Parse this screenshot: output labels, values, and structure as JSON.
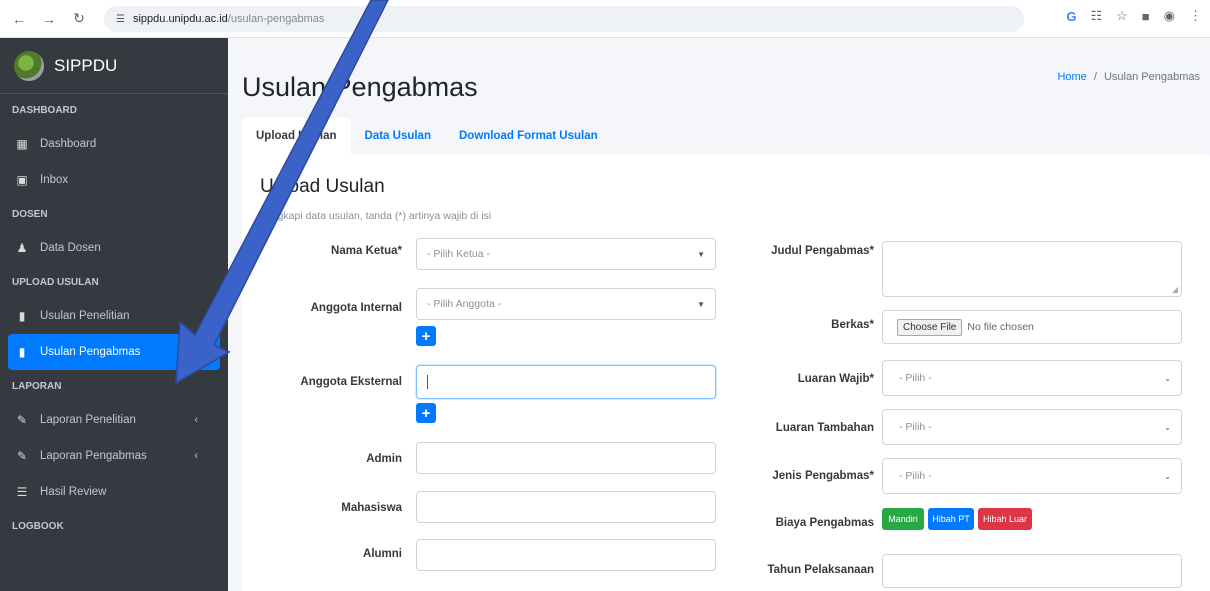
{
  "browser": {
    "url_domain": "sippdu.unipdu.ac.id",
    "url_path": "/usulan-pengabmas"
  },
  "sidebar": {
    "brand": "SIPPDU",
    "sections": [
      {
        "header": "DASHBOARD",
        "items": [
          {
            "label": "Dashboard",
            "icon": "grid-icon"
          },
          {
            "label": "Inbox",
            "icon": "inbox-icon"
          }
        ]
      },
      {
        "header": "DOSEN",
        "items": [
          {
            "label": "Data Dosen",
            "icon": "users-icon"
          }
        ]
      },
      {
        "header": "UPLOAD USULAN",
        "items": [
          {
            "label": "Usulan Penelitian",
            "icon": "file-icon"
          },
          {
            "label": "Usulan Pengabmas",
            "icon": "file-icon",
            "active": true
          }
        ]
      },
      {
        "header": "LAPORAN",
        "items": [
          {
            "label": "Laporan Penelitian",
            "icon": "edit-icon"
          },
          {
            "label": "Laporan Pengabmas",
            "icon": "edit-icon"
          },
          {
            "label": "Hasil Review",
            "icon": "list-icon"
          }
        ]
      },
      {
        "header": "LOGBOOK",
        "items": []
      }
    ]
  },
  "page": {
    "title": "Usulan Pengabmas",
    "breadcrumb_home": "Home",
    "breadcrumb_sep": "/",
    "breadcrumb_current": "Usulan Pengabmas"
  },
  "tabs": [
    {
      "label": "Upload Usulan",
      "active": true
    },
    {
      "label": "Data Usulan"
    },
    {
      "label": "Download Format Usulan"
    }
  ],
  "card": {
    "title": "Upload Usulan",
    "subtitle": "Lengkapi data usulan, tanda (*) artinya wajib di isi"
  },
  "form": {
    "nama_ketua_label": "Nama Ketua*",
    "nama_ketua_placeholder": "- Pilih Ketua -",
    "anggota_internal_label": "Anggota Internal",
    "anggota_internal_placeholder": "- Pilih Anggota -",
    "anggota_eksternal_label": "Anggota Eksternal",
    "admin_label": "Admin",
    "mahasiswa_label": "Mahasiswa",
    "alumni_label": "Alumni",
    "plus_label": "+",
    "judul_label": "Judul Pengabmas*",
    "berkas_label": "Berkas*",
    "choose_file": "Choose File",
    "no_file": "No file chosen",
    "luaran_wajib_label": "Luaran Wajib*",
    "luaran_wajib_value": "- Pilih -",
    "luaran_tambahan_label": "Luaran Tambahan",
    "luaran_tambahan_value": "- Pilih -",
    "jenis_label": "Jenis Pengabmas*",
    "jenis_value": "- Pilih -",
    "biaya_label": "Biaya Pengabmas",
    "biaya_options": [
      "Mandiri",
      "Hibah PT",
      "Hibah Luar"
    ],
    "tahun_label": "Tahun Pelaksanaan"
  },
  "colors": {
    "sidebar_bg": "#343a40",
    "primary": "#007bff",
    "success": "#28a745",
    "danger": "#dc3545",
    "arrow": "#3a62c9"
  }
}
